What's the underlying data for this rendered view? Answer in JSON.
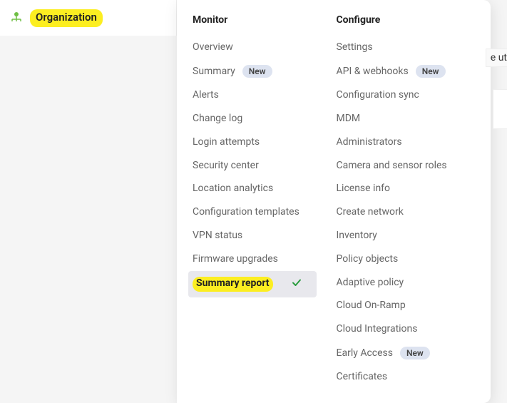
{
  "topbar": {
    "org_label": "Organization"
  },
  "flyout": {
    "col1": {
      "header": "Monitor",
      "items": [
        {
          "label": "Overview"
        },
        {
          "label": "Summary",
          "badge": "New"
        },
        {
          "label": "Alerts"
        },
        {
          "label": "Change log"
        },
        {
          "label": "Login attempts"
        },
        {
          "label": "Security center"
        },
        {
          "label": "Location analytics"
        },
        {
          "label": "Configuration templates"
        },
        {
          "label": "VPN status"
        },
        {
          "label": "Firmware upgrades"
        },
        {
          "label": "Summary report"
        }
      ]
    },
    "col2": {
      "header": "Configure",
      "items": [
        {
          "label": "Settings"
        },
        {
          "label": "API & webhooks",
          "badge": "New"
        },
        {
          "label": "Configuration sync"
        },
        {
          "label": "MDM"
        },
        {
          "label": "Administrators"
        },
        {
          "label": "Camera and sensor roles"
        },
        {
          "label": "License info"
        },
        {
          "label": "Create network"
        },
        {
          "label": "Inventory"
        },
        {
          "label": "Policy objects"
        },
        {
          "label": "Adaptive policy"
        },
        {
          "label": "Cloud On-Ramp"
        },
        {
          "label": "Cloud Integrations"
        },
        {
          "label": "Early Access",
          "badge": "New"
        },
        {
          "label": "Certificates"
        }
      ]
    }
  },
  "partial": {
    "text": "e ut"
  }
}
